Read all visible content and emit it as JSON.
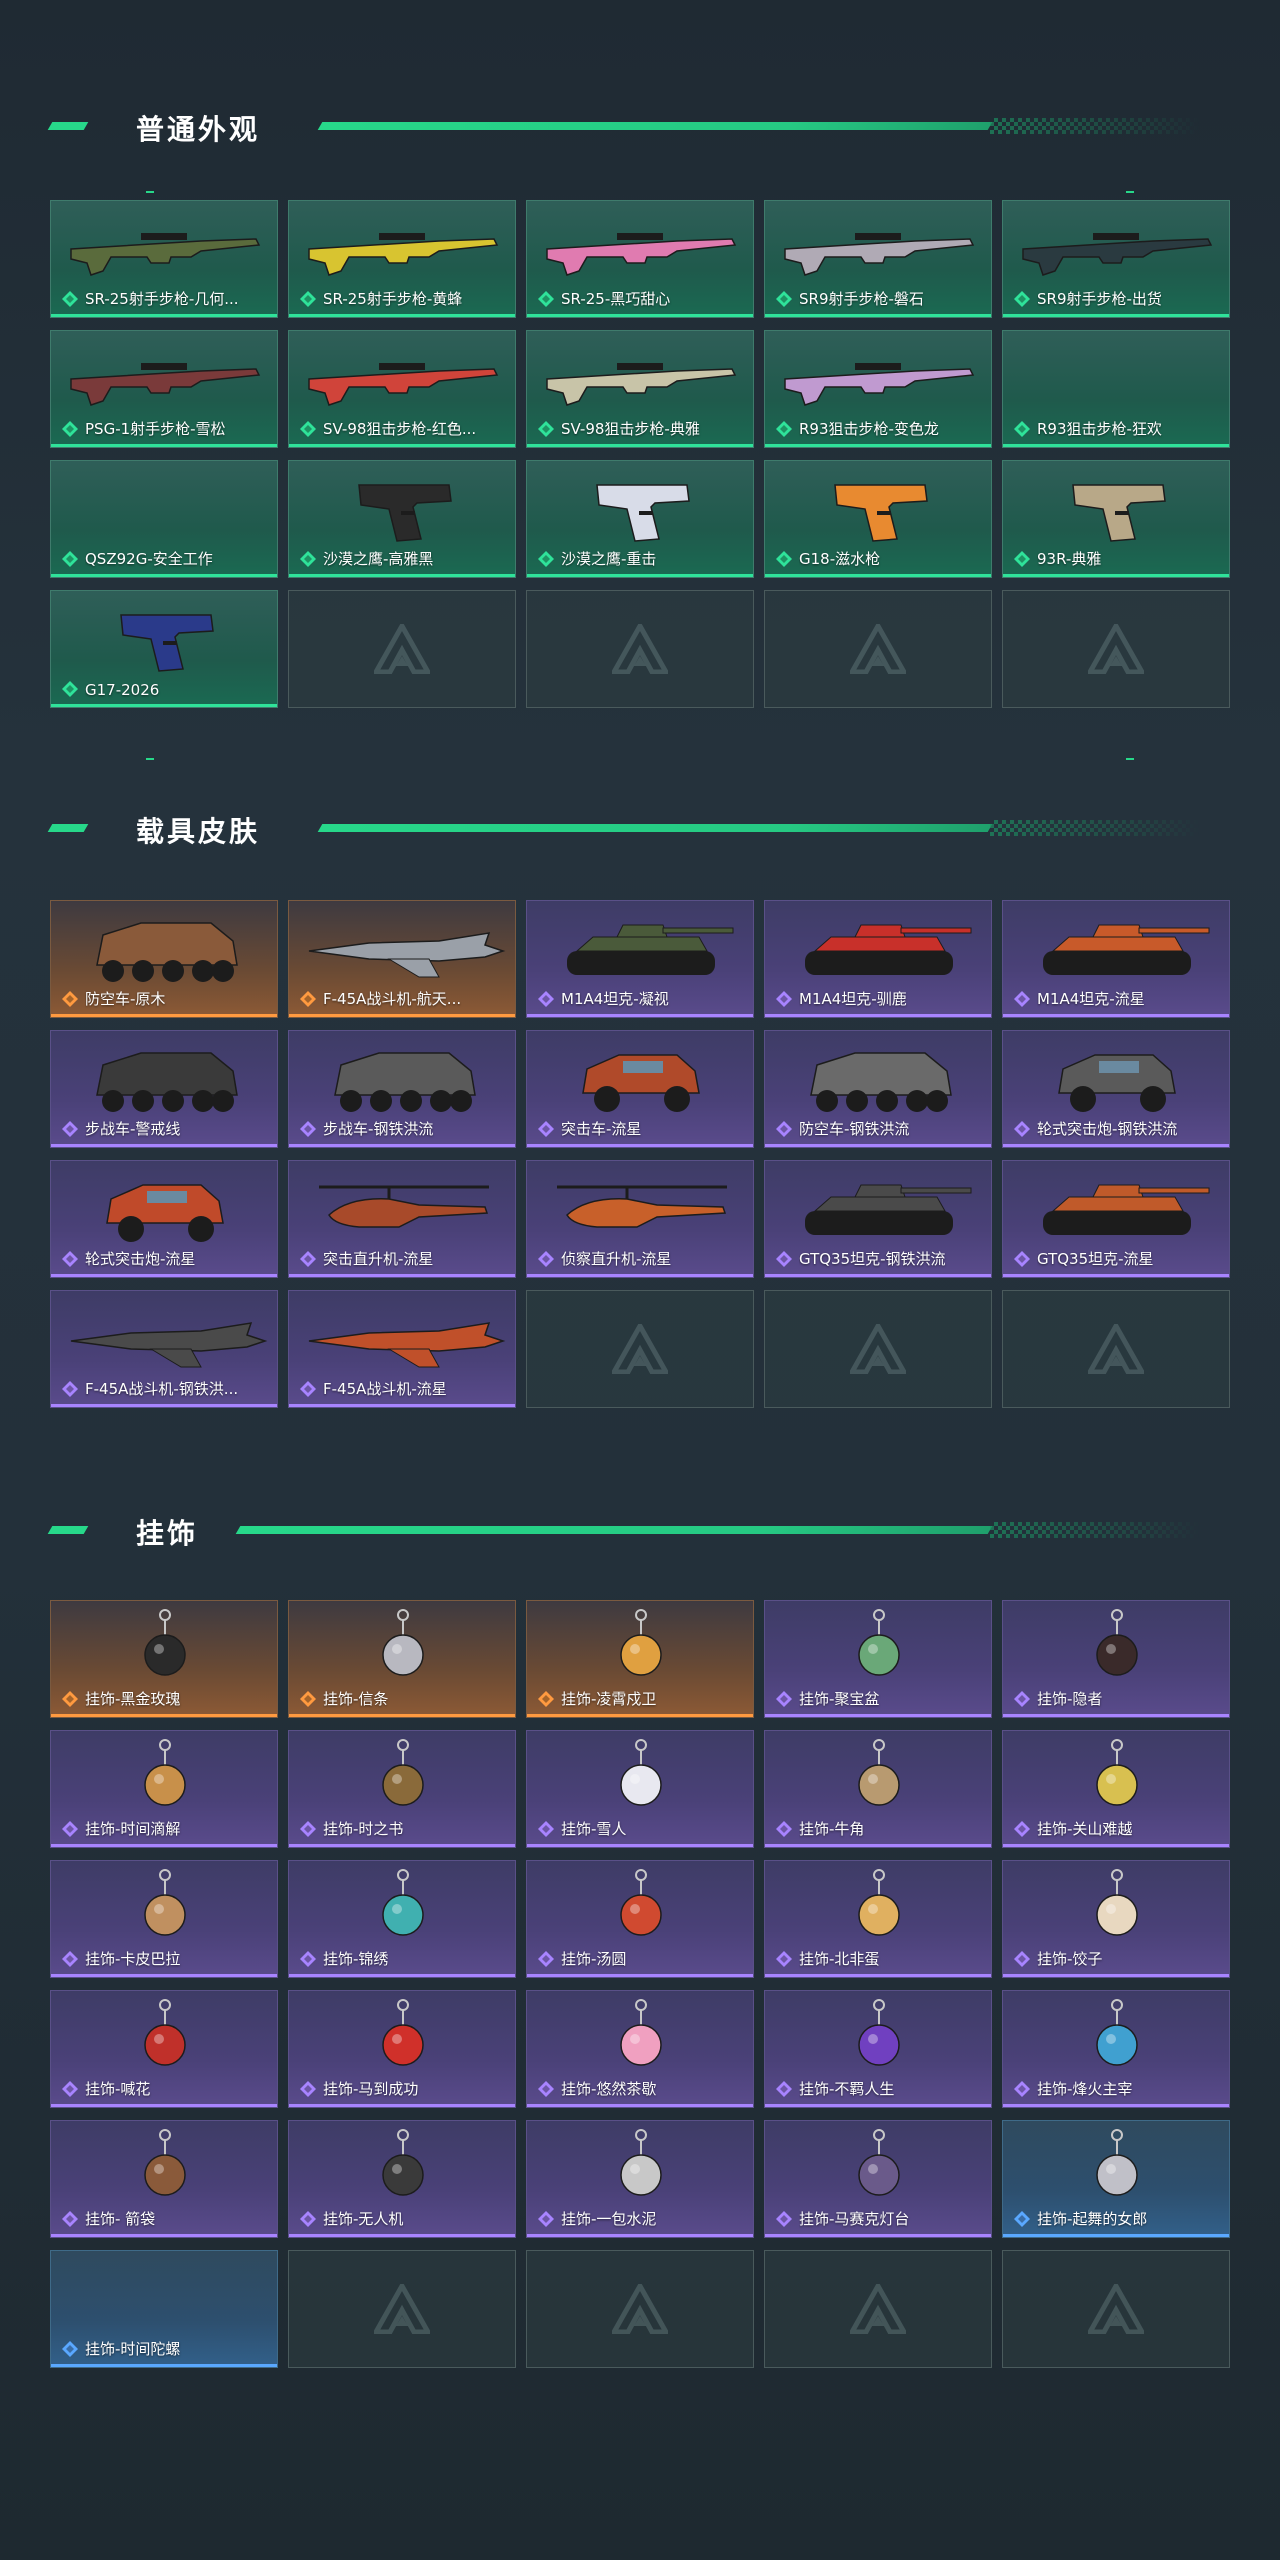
{
  "colors": {
    "accent": "#27d88a",
    "green_rarity": "#2fe39a",
    "purple_rarity": "#a884ff",
    "orange_rarity": "#ff9a40",
    "blue_rarity": "#5aa8ff"
  },
  "sections": [
    {
      "title": "普通外观",
      "items": [
        {
          "label": "SR-25射手步枪-几何...",
          "rarity": "green",
          "art": "rifle",
          "tint": "#5a6b3c"
        },
        {
          "label": "SR-25射手步枪-黄蜂",
          "rarity": "green",
          "art": "rifle",
          "tint": "#d8c430"
        },
        {
          "label": "SR-25-黑巧甜心",
          "rarity": "green",
          "art": "rifle",
          "tint": "#e07bb0"
        },
        {
          "label": "SR9射手步枪-磐石",
          "rarity": "green",
          "art": "rifle",
          "tint": "#b0aab5"
        },
        {
          "label": "SR9射手步枪-出货",
          "rarity": "green",
          "art": "rifle",
          "tint": "#2a3a40"
        },
        {
          "label": "PSG-1射手步枪-雪松",
          "rarity": "green",
          "art": "rifle",
          "tint": "#7a3a3a"
        },
        {
          "label": "SV-98狙击步枪-红色...",
          "rarity": "green",
          "art": "rifle",
          "tint": "#d0443a"
        },
        {
          "label": "SV-98狙击步枪-典雅",
          "rarity": "green",
          "art": "rifle",
          "tint": "#c8c4a8"
        },
        {
          "label": "R93狙击步枪-变色龙",
          "rarity": "green",
          "art": "rifle",
          "tint": "#c09ad0"
        },
        {
          "label": "R93狙击步枪-狂欢",
          "rarity": "green",
          "art": "none",
          "tint": ""
        },
        {
          "label": "QSZ92G-安全工作",
          "rarity": "green",
          "art": "none",
          "tint": ""
        },
        {
          "label": "沙漠之鹰-高雅黑",
          "rarity": "green",
          "art": "pistol",
          "tint": "#2a2a2a"
        },
        {
          "label": "沙漠之鹰-重击",
          "rarity": "green",
          "art": "pistol",
          "tint": "#d8dce8"
        },
        {
          "label": "G18-滋水枪",
          "rarity": "green",
          "art": "pistol",
          "tint": "#e88a30"
        },
        {
          "label": "93R-典雅",
          "rarity": "green",
          "art": "pistol",
          "tint": "#b8a888"
        },
        {
          "label": "G17-2026",
          "rarity": "green",
          "art": "pistol",
          "tint": "#2a3a8a"
        },
        {
          "label": "",
          "rarity": "empty"
        },
        {
          "label": "",
          "rarity": "empty"
        },
        {
          "label": "",
          "rarity": "empty"
        },
        {
          "label": "",
          "rarity": "empty"
        }
      ]
    },
    {
      "title": "载具皮肤",
      "items": [
        {
          "label": "防空车-原木",
          "rarity": "orange",
          "art": "apc",
          "tint": "#8a5a3a"
        },
        {
          "label": "F-45A战斗机-航天...",
          "rarity": "orange",
          "art": "jet",
          "tint": "#9aa0a8"
        },
        {
          "label": "M1A4坦克-凝视",
          "rarity": "purple",
          "art": "tank",
          "tint": "#4a5a3a"
        },
        {
          "label": "M1A4坦克-驯鹿",
          "rarity": "purple",
          "art": "tank",
          "tint": "#c8302a"
        },
        {
          "label": "M1A4坦克-流星",
          "rarity": "purple",
          "art": "tank",
          "tint": "#c85a2a"
        },
        {
          "label": "步战车-警戒线",
          "rarity": "purple",
          "art": "apc",
          "tint": "#3a3a3a"
        },
        {
          "label": "步战车-钢铁洪流",
          "rarity": "purple",
          "art": "apc",
          "tint": "#5a5a5a"
        },
        {
          "label": "突击车-流星",
          "rarity": "purple",
          "art": "truck",
          "tint": "#b04a2a"
        },
        {
          "label": "防空车-钢铁洪流",
          "rarity": "purple",
          "art": "apc",
          "tint": "#6a6a6a"
        },
        {
          "label": "轮式突击炮-钢铁洪流",
          "rarity": "purple",
          "art": "truck",
          "tint": "#5a5a5a"
        },
        {
          "label": "轮式突击炮-流星",
          "rarity": "purple",
          "art": "truck",
          "tint": "#c04a2a"
        },
        {
          "label": "突击直升机-流星",
          "rarity": "purple",
          "art": "heli",
          "tint": "#a84a2a"
        },
        {
          "label": "侦察直升机-流星",
          "rarity": "purple",
          "art": "heli",
          "tint": "#c8602a"
        },
        {
          "label": "GTQ35坦克-钢铁洪流",
          "rarity": "purple",
          "art": "tank",
          "tint": "#4a4a4a"
        },
        {
          "label": "GTQ35坦克-流星",
          "rarity": "purple",
          "art": "tank",
          "tint": "#c05a2a"
        },
        {
          "label": "F-45A战斗机-钢铁洪...",
          "rarity": "purple",
          "art": "jet",
          "tint": "#4a4a4a"
        },
        {
          "label": "F-45A战斗机-流星",
          "rarity": "purple",
          "art": "jet",
          "tint": "#c0502a"
        },
        {
          "label": "",
          "rarity": "empty"
        },
        {
          "label": "",
          "rarity": "empty"
        },
        {
          "label": "",
          "rarity": "empty"
        }
      ]
    },
    {
      "title": "挂饰",
      "items": [
        {
          "label": "挂饰-黑金玫瑰",
          "rarity": "orange",
          "art": "charm",
          "tint": "#2a2a2a"
        },
        {
          "label": "挂饰-信条",
          "rarity": "orange",
          "art": "charm",
          "tint": "#b8b8c0"
        },
        {
          "label": "挂饰-凌霄戍卫",
          "rarity": "orange",
          "art": "charm",
          "tint": "#e0a040"
        },
        {
          "label": "挂饰-聚宝盆",
          "rarity": "purple",
          "art": "charm",
          "tint": "#6aa878"
        },
        {
          "label": "挂饰-隐者",
          "rarity": "purple",
          "art": "charm",
          "tint": "#3a2a2a"
        },
        {
          "label": "挂饰-时间滴解",
          "rarity": "purple",
          "art": "charm",
          "tint": "#c8904a"
        },
        {
          "label": "挂饰-时之书",
          "rarity": "purple",
          "art": "charm",
          "tint": "#8a6a3a"
        },
        {
          "label": "挂饰-雪人",
          "rarity": "purple",
          "art": "charm",
          "tint": "#e8e8f0"
        },
        {
          "label": "挂饰-牛角",
          "rarity": "purple",
          "art": "charm",
          "tint": "#b89a70"
        },
        {
          "label": "挂饰-关山难越",
          "rarity": "purple",
          "art": "charm",
          "tint": "#d8c050"
        },
        {
          "label": "挂饰-卡皮巴拉",
          "rarity": "purple",
          "art": "charm",
          "tint": "#c09060"
        },
        {
          "label": "挂饰-锦绣",
          "rarity": "purple",
          "art": "charm",
          "tint": "#40b0b0"
        },
        {
          "label": "挂饰-汤圆",
          "rarity": "purple",
          "art": "charm",
          "tint": "#d04a30"
        },
        {
          "label": "挂饰-北非蛋",
          "rarity": "purple",
          "art": "charm",
          "tint": "#e0b060"
        },
        {
          "label": "挂饰-饺子",
          "rarity": "purple",
          "art": "charm",
          "tint": "#e8d8c0"
        },
        {
          "label": "挂饰-喊花",
          "rarity": "purple",
          "art": "charm",
          "tint": "#c0302a"
        },
        {
          "label": "挂饰-马到成功",
          "rarity": "purple",
          "art": "charm",
          "tint": "#d0302a"
        },
        {
          "label": "挂饰-悠然茶歇",
          "rarity": "purple",
          "art": "charm",
          "tint": "#f0a0c0"
        },
        {
          "label": "挂饰-不羁人生",
          "rarity": "purple",
          "art": "charm",
          "tint": "#7040c0"
        },
        {
          "label": "挂饰-烽火主宰",
          "rarity": "purple",
          "art": "charm",
          "tint": "#40a0d0"
        },
        {
          "label": "挂饰- 箭袋",
          "rarity": "purple",
          "art": "charm",
          "tint": "#8a5a3a"
        },
        {
          "label": "挂饰-无人机",
          "rarity": "purple",
          "art": "charm",
          "tint": "#3a3a3a"
        },
        {
          "label": "挂饰-一包水泥",
          "rarity": "purple",
          "art": "charm",
          "tint": "#c8c8c8"
        },
        {
          "label": "挂饰-马赛克灯台",
          "rarity": "purple",
          "art": "charm",
          "tint": "#6a5a8a"
        },
        {
          "label": "挂饰-起舞的女郎",
          "rarity": "blue",
          "art": "charm",
          "tint": "#c0c0c8"
        },
        {
          "label": "挂饰-时间陀螺",
          "rarity": "blue",
          "art": "none",
          "tint": ""
        },
        {
          "label": "",
          "rarity": "empty"
        },
        {
          "label": "",
          "rarity": "empty"
        },
        {
          "label": "",
          "rarity": "empty"
        },
        {
          "label": "",
          "rarity": "empty"
        }
      ]
    }
  ]
}
